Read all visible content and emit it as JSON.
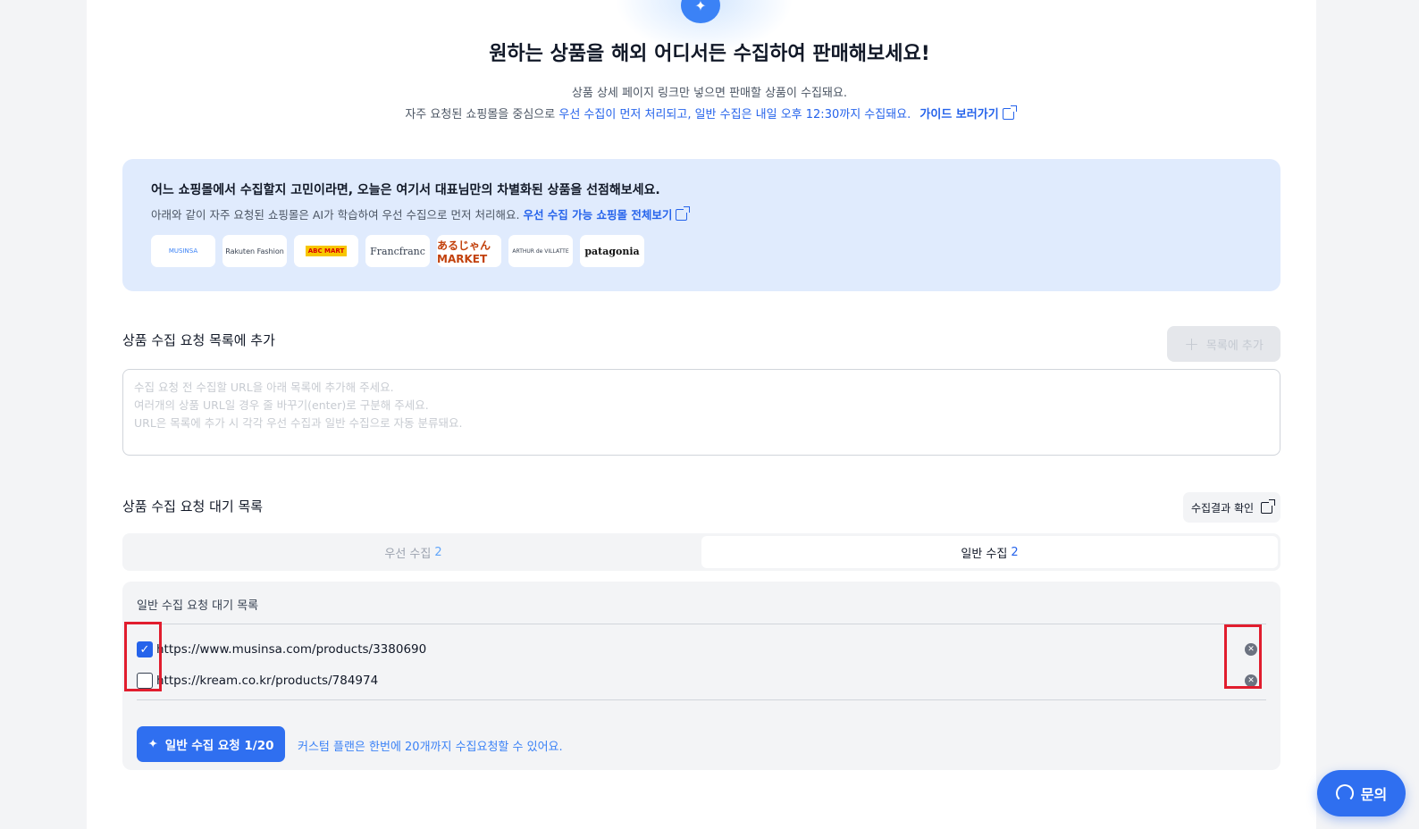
{
  "hero": {
    "badge_icon": "sparkle-icon",
    "title": "원하는 상품을 해외 어디서든 수집하여 판매해보세요!",
    "line1": "상품 상세 페이지 링크만 넣으면 판매할 상품이 수집돼요.",
    "line2_prefix": "자주 요청된 쇼핑몰을 중심으로",
    "line2_highlight": "우선 수집이 먼저 처리되고, 일반 수집은 내일 오후 12:30까지 수집돼요.",
    "guide_link": "가이드 보러가기"
  },
  "info": {
    "title": "어느 쇼핑몰에서 수집할지 고민이라면, 오늘은 여기서 대표님만의 차별화된 상품을 선점해보세요.",
    "desc": "아래와 같이 자주 요청된 쇼핑몰은 AI가 학습하여 우선 수집으로 먼저 처리해요.",
    "link": "우선 수집 가능 쇼핑몰 전체보기",
    "logos": [
      "MUSINSA",
      "Rakuten Fashion",
      "ABC MART",
      "Francfranc",
      "あるじゃん MARKET",
      "ARTHUR de VILLATTE",
      "patagonia"
    ]
  },
  "add_section": {
    "title": "상품 수집 요청 목록에 추가",
    "add_button": "목록에 추가",
    "placeholder": "수집 요청 전 수집할 URL을 아래 목록에 추가해 주세요.\n여러개의 상품 URL일 경우 줄 바꾸기(enter)로 구분해 주세요.\nURL은 목록에 추가 시 각각 우선 수집과 일반 수집으로 자동 분류돼요."
  },
  "queue": {
    "title": "상품 수집 요청 대기 목록",
    "result_button": "수집결과 확인",
    "tabs": [
      {
        "label": "우선 수집",
        "count": "2"
      },
      {
        "label": "일반 수집",
        "count": "2"
      }
    ],
    "active_tab": 1,
    "list_title": "일반 수집 요청 대기 목록",
    "items": [
      {
        "url": "https://www.musinsa.com/products/3380690",
        "checked": true
      },
      {
        "url": "https://kream.co.kr/products/784974",
        "checked": false
      }
    ],
    "request_button": "일반 수집 요청 1/20",
    "note": "커스텀 플랜은 한번에 20개까지 수집요청할 수 있어요."
  },
  "inquiry": {
    "label": "문의",
    "icon": "headset-icon"
  },
  "colors": {
    "accent": "#2f6ff0",
    "highlight_box": "#e11d2e",
    "info_bg": "#e0ebfd"
  }
}
